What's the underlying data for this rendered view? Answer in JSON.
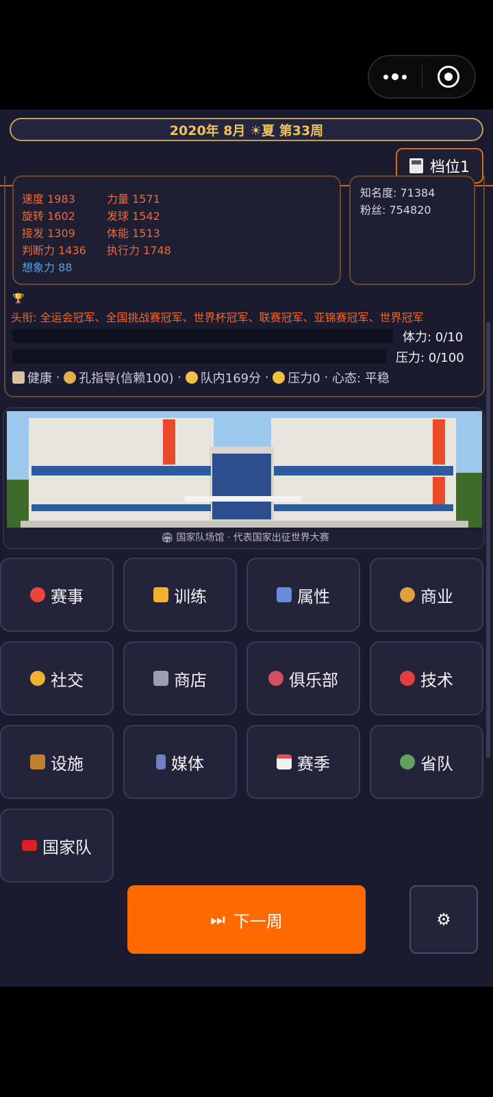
{
  "header": {
    "date": "2020年 8月 ☀夏 第33周",
    "save_slot": "档位1"
  },
  "player": {
    "stats_left": [
      {
        "label": "速度",
        "value": "1983"
      },
      {
        "label": "旋转",
        "value": "1602"
      },
      {
        "label": "接发",
        "value": "1309"
      },
      {
        "label": "判断力",
        "value": "1436"
      },
      {
        "label": "想象力",
        "value": "88"
      }
    ],
    "stats_right": [
      {
        "label": "力量",
        "value": "1571"
      },
      {
        "label": "发球",
        "value": "1542"
      },
      {
        "label": "体能",
        "value": "1513"
      },
      {
        "label": "执行力",
        "value": "1748"
      }
    ],
    "fame": "知名度: 71384",
    "fans": "粉丝: 754820",
    "titles_label": "头衔:",
    "titles": "全运会冠军、全国挑战赛冠军、世界杯冠军、联赛冠军、亚锦赛冠军、世界冠军",
    "stamina": "体力: 0/10",
    "stamina_fraction": 0.0,
    "pressure": "压力: 0/100",
    "pressure_fraction": 0.0,
    "status": {
      "health": "健康",
      "coach": "孔指导(信赖100)",
      "team_score": "队内169分",
      "pressure": "压力0",
      "mood": "心态: 平稳"
    }
  },
  "venue": {
    "caption": "国家队场馆 · 代表国家出征世界大赛"
  },
  "menu": [
    {
      "label": "赛事",
      "icon": "ping-pong-icon",
      "color": "#e8463a"
    },
    {
      "label": "训练",
      "icon": "muscle-icon",
      "color": "#f0b030"
    },
    {
      "label": "属性",
      "icon": "bar-chart-icon",
      "color": "#6a8ae0"
    },
    {
      "label": "商业",
      "icon": "money-bag-icon",
      "color": "#e0a040"
    },
    {
      "label": "社交",
      "icon": "handshake-icon",
      "color": "#f0b030"
    },
    {
      "label": "商店",
      "icon": "cart-icon",
      "color": "#9aa0b0"
    },
    {
      "label": "俱乐部",
      "icon": "stadium-icon",
      "color": "#d05060"
    },
    {
      "label": "技术",
      "icon": "target-icon",
      "color": "#e04040"
    },
    {
      "label": "设施",
      "icon": "crane-icon",
      "color": "#c08030"
    },
    {
      "label": "媒体",
      "icon": "phone-icon",
      "color": "#7080c0"
    },
    {
      "label": "赛季",
      "icon": "calendar-icon",
      "color": "#e05050"
    },
    {
      "label": "省队",
      "icon": "badge-icon",
      "color": "#60a060"
    },
    {
      "label": "国家队",
      "icon": "china-flag-icon",
      "color": "#e02020"
    }
  ],
  "footer": {
    "next_week": "下一周",
    "settings_icon": "gear-icon"
  }
}
